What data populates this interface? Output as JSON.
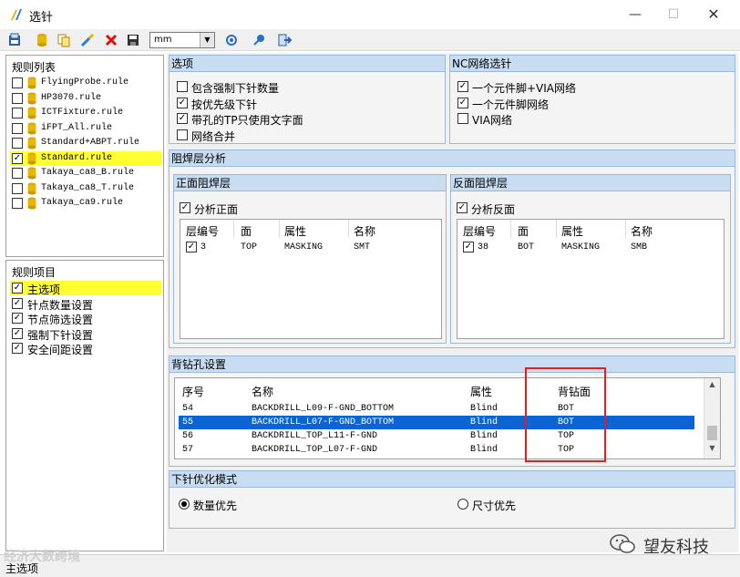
{
  "window": {
    "title": "选针",
    "minimize": "—",
    "maximize": "☐",
    "close": "✕"
  },
  "toolbar": {
    "unit_value": "mm",
    "icons": [
      "import-icon",
      "database-icon",
      "copy-icon",
      "probe-icon",
      "delete-icon",
      "save-icon",
      "refresh-icon",
      "pin-icon",
      "exit-icon"
    ]
  },
  "rule_list": {
    "title": "规则列表",
    "items": [
      {
        "label": "FlyingProbe.rule",
        "checked": false,
        "selected": false
      },
      {
        "label": "HP3070.rule",
        "checked": false,
        "selected": false
      },
      {
        "label": "ICTFixture.rule",
        "checked": false,
        "selected": false
      },
      {
        "label": "iFPT_All.rule",
        "checked": false,
        "selected": false
      },
      {
        "label": "Standard+ABPT.rule",
        "checked": false,
        "selected": false
      },
      {
        "label": "Standard.rule",
        "checked": true,
        "selected": true
      },
      {
        "label": "Takaya_ca8_B.rule",
        "checked": false,
        "selected": false
      },
      {
        "label": "Takaya_ca8_T.rule",
        "checked": false,
        "selected": false
      },
      {
        "label": "Takaya_ca9.rule",
        "checked": false,
        "selected": false
      }
    ]
  },
  "rule_items": {
    "title": "规则项目",
    "items": [
      {
        "label": "主选项",
        "checked": true,
        "selected": true
      },
      {
        "label": "针点数量设置",
        "checked": true,
        "selected": false
      },
      {
        "label": "节点筛选设置",
        "checked": true,
        "selected": false
      },
      {
        "label": "强制下针设置",
        "checked": true,
        "selected": false
      },
      {
        "label": "安全间距设置",
        "checked": true,
        "selected": false
      }
    ]
  },
  "options": {
    "title": "选项",
    "items": [
      {
        "label": "包含强制下针数量",
        "checked": false
      },
      {
        "label": "按优先级下针",
        "checked": true
      },
      {
        "label": "带孔的TP只使用文字面",
        "checked": true
      },
      {
        "label": "网络合并",
        "checked": false
      }
    ]
  },
  "nc_net": {
    "title": "NC网络选针",
    "items": [
      {
        "label": "一个元件脚+VIA网络",
        "checked": true
      },
      {
        "label": "一个元件脚网络",
        "checked": true
      },
      {
        "label": "VIA网络",
        "checked": false
      }
    ]
  },
  "solder_mask": {
    "title": "阻焊层分析",
    "front": {
      "title": "正面阻焊层",
      "analyze_label": "分析正面",
      "columns": [
        "层编号",
        "面",
        "属性",
        "名称"
      ],
      "rows": [
        {
          "layer": "3",
          "side": "TOP",
          "attr": "MASKING",
          "name": "SMT",
          "checked": true
        }
      ]
    },
    "back": {
      "title": "反面阻焊层",
      "analyze_label": "分析反面",
      "columns": [
        "层编号",
        "面",
        "属性",
        "名称"
      ],
      "rows": [
        {
          "layer": "38",
          "side": "BOT",
          "attr": "MASKING",
          "name": "SMB",
          "checked": true
        }
      ]
    }
  },
  "backdrill": {
    "title": "背钻孔设置",
    "columns": [
      "序号",
      "名称",
      "属性",
      "背钻面"
    ],
    "rows": [
      {
        "no": "54",
        "name": "BACKDRILL_L09-F-GND_BOTTOM",
        "attr": "Blind",
        "side": "BOT",
        "selected": false
      },
      {
        "no": "55",
        "name": "BACKDRILL_L07-F-GND_BOTTOM",
        "attr": "Blind",
        "side": "BOT",
        "selected": true
      },
      {
        "no": "56",
        "name": "BACKDRILL_TOP_L11-F-GND",
        "attr": "Blind",
        "side": "TOP",
        "selected": false
      },
      {
        "no": "57",
        "name": "BACKDRILL_TOP_L07-F-GND",
        "attr": "Blind",
        "side": "TOP",
        "selected": false
      }
    ]
  },
  "probe_mode": {
    "title": "下针优化模式",
    "options": [
      {
        "label": "数量优先",
        "selected": true
      },
      {
        "label": "尺寸优先",
        "selected": false
      }
    ]
  },
  "status": {
    "text": "主选项"
  },
  "watermark": {
    "left": "经济大数跨境",
    "right": "望友科技"
  },
  "colors": {
    "selection_yellow": "#ffff33",
    "group_header": "#c8dcf2",
    "row_select_blue": "#0a64d2",
    "highlight_red": "#e02020"
  }
}
